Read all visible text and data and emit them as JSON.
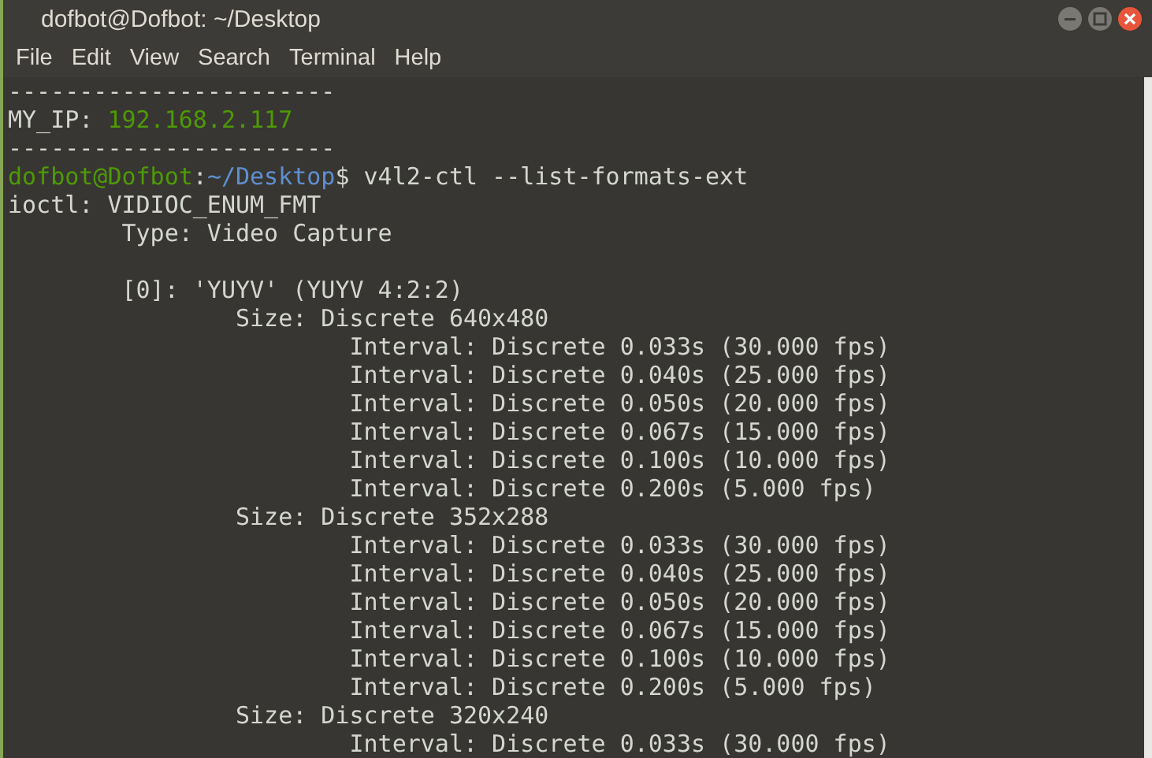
{
  "window": {
    "title": "dofbot@Dofbot: ~/Desktop"
  },
  "menu": [
    "File",
    "Edit",
    "View",
    "Search",
    "Terminal",
    "Help"
  ],
  "terminal": {
    "lines": [
      {
        "kind": "text",
        "segments": [
          {
            "kind": "output",
            "text": "-----------------------"
          }
        ]
      },
      {
        "kind": "text",
        "segments": [
          {
            "kind": "output",
            "text": "MY_IP: "
          },
          {
            "kind": "ip",
            "text": "192.168.2.117"
          }
        ]
      },
      {
        "kind": "text",
        "segments": [
          {
            "kind": "output",
            "text": "-----------------------"
          }
        ]
      },
      {
        "kind": "text",
        "segments": [
          {
            "kind": "user",
            "text": "dofbot@Dofbot"
          },
          {
            "kind": "output",
            "text": ":"
          },
          {
            "kind": "path",
            "text": "~/Desktop"
          },
          {
            "kind": "output",
            "text": "$ v4l2-ctl --list-formats-ext"
          }
        ]
      },
      {
        "kind": "text",
        "segments": [
          {
            "kind": "output",
            "text": "ioctl: VIDIOC_ENUM_FMT"
          }
        ]
      },
      {
        "kind": "text",
        "segments": [
          {
            "kind": "output",
            "text": "        Type: Video Capture"
          }
        ]
      },
      {
        "kind": "blank"
      },
      {
        "kind": "text",
        "segments": [
          {
            "kind": "output",
            "text": "        [0]: 'YUYV' (YUYV 4:2:2)"
          }
        ]
      },
      {
        "kind": "text",
        "segments": [
          {
            "kind": "output",
            "text": "                Size: Discrete 640x480"
          }
        ]
      },
      {
        "kind": "text",
        "segments": [
          {
            "kind": "output",
            "text": "                        Interval: Discrete 0.033s (30.000 fps)"
          }
        ]
      },
      {
        "kind": "text",
        "segments": [
          {
            "kind": "output",
            "text": "                        Interval: Discrete 0.040s (25.000 fps)"
          }
        ]
      },
      {
        "kind": "text",
        "segments": [
          {
            "kind": "output",
            "text": "                        Interval: Discrete 0.050s (20.000 fps)"
          }
        ]
      },
      {
        "kind": "text",
        "segments": [
          {
            "kind": "output",
            "text": "                        Interval: Discrete 0.067s (15.000 fps)"
          }
        ]
      },
      {
        "kind": "text",
        "segments": [
          {
            "kind": "output",
            "text": "                        Interval: Discrete 0.100s (10.000 fps)"
          }
        ]
      },
      {
        "kind": "text",
        "segments": [
          {
            "kind": "output",
            "text": "                        Interval: Discrete 0.200s (5.000 fps)"
          }
        ]
      },
      {
        "kind": "text",
        "segments": [
          {
            "kind": "output",
            "text": "                Size: Discrete 352x288"
          }
        ]
      },
      {
        "kind": "text",
        "segments": [
          {
            "kind": "output",
            "text": "                        Interval: Discrete 0.033s (30.000 fps)"
          }
        ]
      },
      {
        "kind": "text",
        "segments": [
          {
            "kind": "output",
            "text": "                        Interval: Discrete 0.040s (25.000 fps)"
          }
        ]
      },
      {
        "kind": "text",
        "segments": [
          {
            "kind": "output",
            "text": "                        Interval: Discrete 0.050s (20.000 fps)"
          }
        ]
      },
      {
        "kind": "text",
        "segments": [
          {
            "kind": "output",
            "text": "                        Interval: Discrete 0.067s (15.000 fps)"
          }
        ]
      },
      {
        "kind": "text",
        "segments": [
          {
            "kind": "output",
            "text": "                        Interval: Discrete 0.100s (10.000 fps)"
          }
        ]
      },
      {
        "kind": "text",
        "segments": [
          {
            "kind": "output",
            "text": "                        Interval: Discrete 0.200s (5.000 fps)"
          }
        ]
      },
      {
        "kind": "text",
        "segments": [
          {
            "kind": "output",
            "text": "                Size: Discrete 320x240"
          }
        ]
      },
      {
        "kind": "text",
        "segments": [
          {
            "kind": "output",
            "text": "                        Interval: Discrete 0.033s (30.000 fps)"
          }
        ]
      }
    ]
  }
}
